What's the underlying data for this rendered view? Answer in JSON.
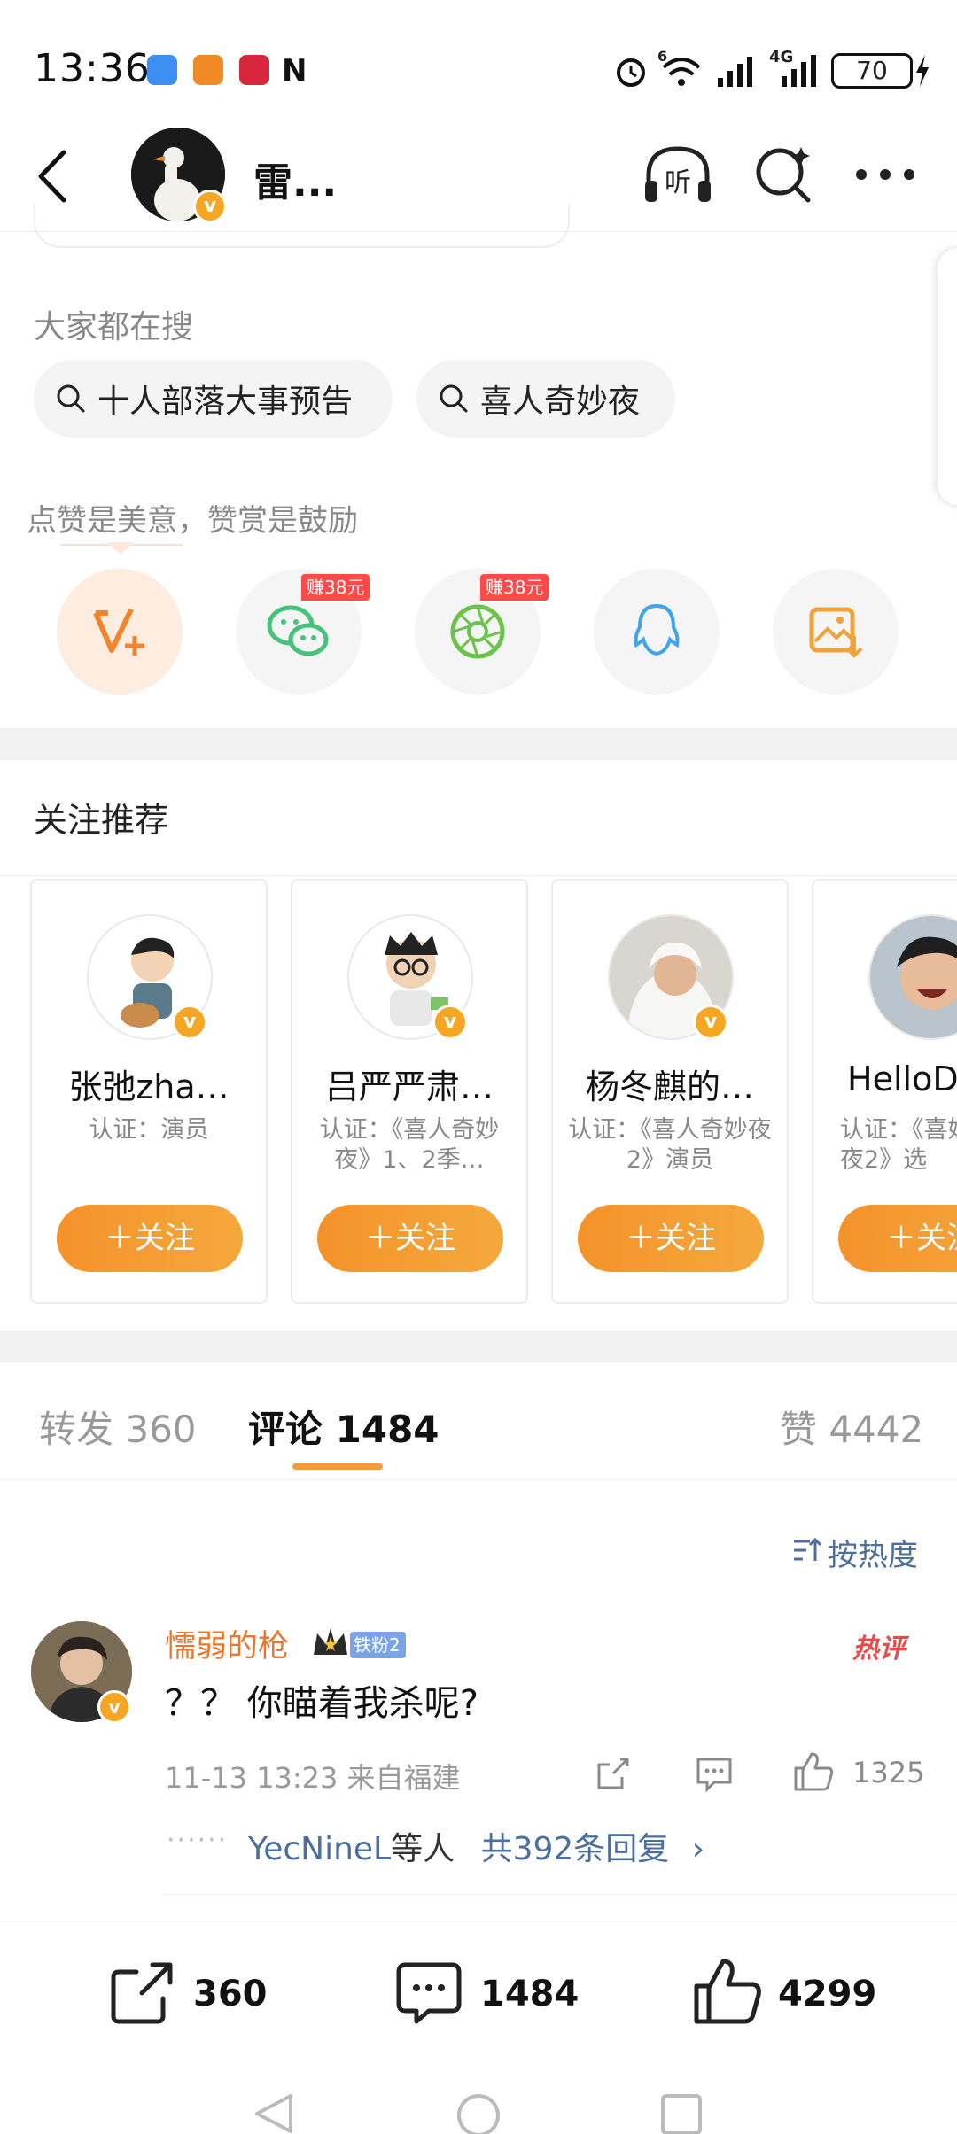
{
  "status_bar": {
    "time": "13:36",
    "network_label": "4G",
    "wifi_label": "6",
    "battery": "70"
  },
  "header": {
    "name": "雷..."
  },
  "trending": {
    "label": "大家都在搜",
    "items": [
      "十人部落大事预告",
      "喜人奇妙夜"
    ]
  },
  "reward": {
    "caption": "点赞是美意，赞赏是鼓励",
    "earn_badge_1": "赚38元",
    "earn_badge_2": "赚38元"
  },
  "recommend": {
    "title": "关注推荐",
    "follow_label": "＋关注",
    "cards": [
      {
        "name": "张弛zha…",
        "desc": "认证：演员"
      },
      {
        "name": "吕严严肃…",
        "desc": "认证：《喜人奇妙夜》1、2季…"
      },
      {
        "name": "杨冬麒的…",
        "desc": "认证：《喜人奇妙夜2》演员"
      },
      {
        "name": "HelloD",
        "desc": "认证：《喜妙夜2》选"
      }
    ]
  },
  "tabs": {
    "repost": "转发 360",
    "comments": "评论 1484",
    "likes": "赞 4442"
  },
  "sort_label": "按热度",
  "comment": {
    "user": "懦弱的枪",
    "fan_badge": "铁粉2",
    "hot_label": "热评",
    "text": "？？ 你瞄着我杀呢?",
    "meta": "11-13 13:23  来自福建",
    "like_count": "1325",
    "reply_user": "YecNineL",
    "reply_suffix": "等人",
    "reply_total": "共392条回复"
  },
  "bottom_bar": {
    "repost_count": "360",
    "comment_count": "1484",
    "like_count": "4299"
  },
  "colors": {
    "accent_orange": "#f39c38",
    "link_blue": "#4b6f9f",
    "username_orange": "#e8792c",
    "earn_red": "#ff4a4a"
  }
}
